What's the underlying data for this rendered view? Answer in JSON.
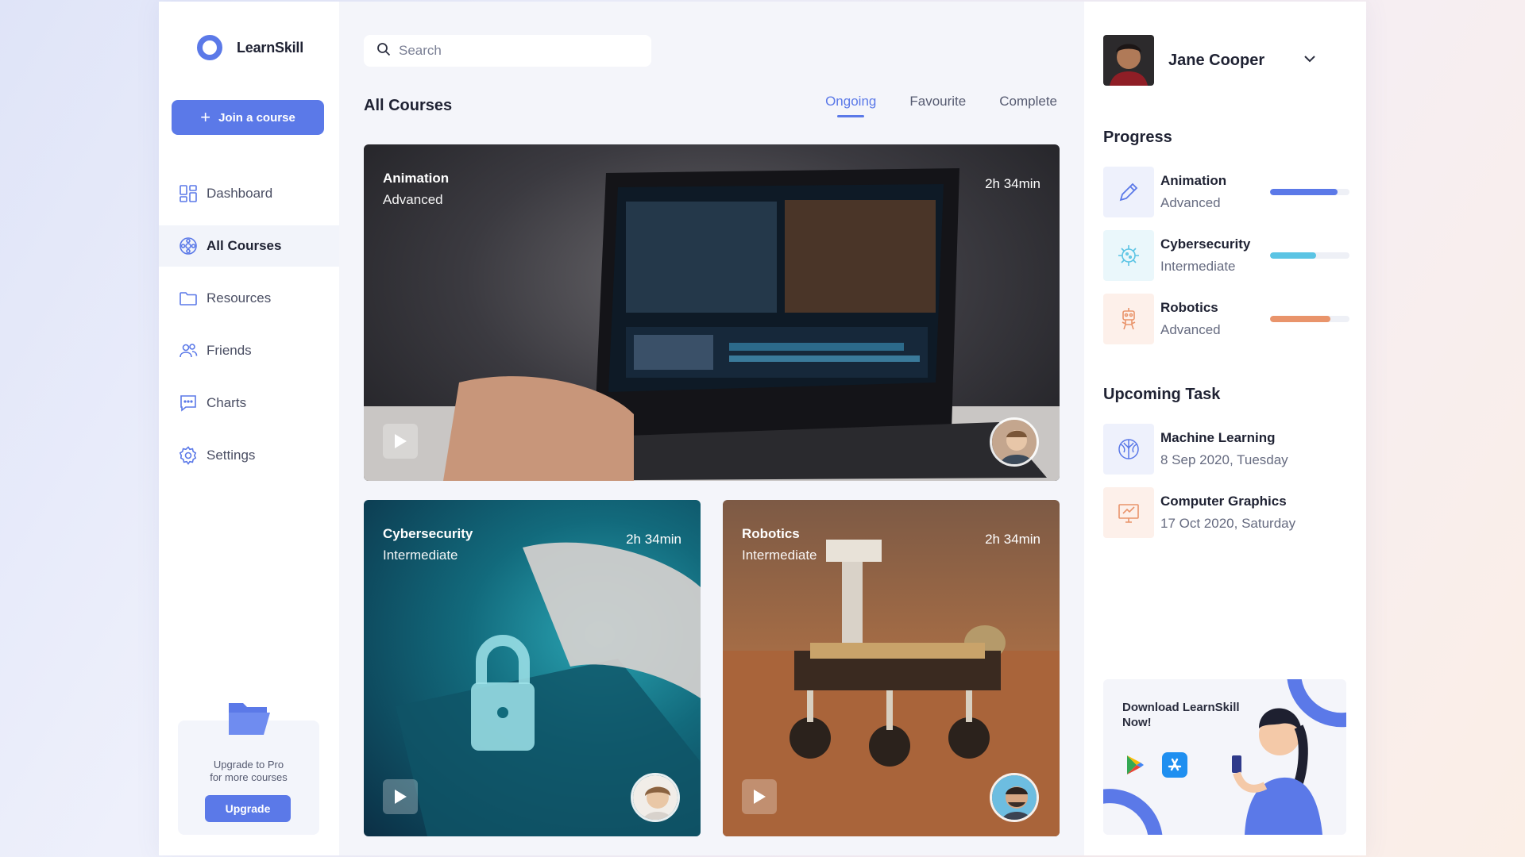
{
  "app": {
    "name": "LearnSkill"
  },
  "sidebar": {
    "join_label": "Join a course",
    "items": [
      {
        "label": "Dashboard",
        "icon": "dashboard-icon"
      },
      {
        "label": "All Courses",
        "icon": "courses-icon",
        "active": true
      },
      {
        "label": "Resources",
        "icon": "folder-icon"
      },
      {
        "label": "Friends",
        "icon": "friends-icon"
      },
      {
        "label": "Charts",
        "icon": "chat-icon"
      },
      {
        "label": "Settings",
        "icon": "gear-icon"
      }
    ],
    "upgrade": {
      "text_line1": "Upgrade to Pro",
      "text_line2": "for more courses",
      "button": "Upgrade"
    }
  },
  "main": {
    "search_placeholder": "Search",
    "title": "All Courses",
    "tabs": [
      {
        "label": "Ongoing",
        "active": true
      },
      {
        "label": "Favourite"
      },
      {
        "label": "Complete"
      }
    ],
    "courses": [
      {
        "title": "Animation",
        "level": "Advanced",
        "duration": "2h 34min"
      },
      {
        "title": "Cybersecurity",
        "level": "Intermediate",
        "duration": "2h 34min"
      },
      {
        "title": "Robotics",
        "level": "Intermediate",
        "duration": "2h 34min"
      }
    ]
  },
  "right": {
    "user_name": "Jane Cooper",
    "progress_title": "Progress",
    "progress": [
      {
        "title": "Animation",
        "level": "Advanced",
        "value": 0.85,
        "color": "#5b79e8",
        "icon": "pencil-icon"
      },
      {
        "title": "Cybersecurity",
        "level": "Intermediate",
        "value": 0.58,
        "color": "#5bc4e4",
        "icon": "virus-icon"
      },
      {
        "title": "Robotics",
        "level": "Advanced",
        "value": 0.76,
        "color": "#e9946b",
        "icon": "robot-icon"
      }
    ],
    "upcoming_title": "Upcoming Task",
    "tasks": [
      {
        "title": "Machine Learning",
        "date": "8 Sep 2020, Tuesday",
        "icon": "brain-icon"
      },
      {
        "title": "Computer Graphics",
        "date": "17 Oct 2020, Saturday",
        "icon": "graphics-icon"
      }
    ],
    "download": {
      "line1": "Download LearnSkill",
      "line2": "Now!"
    }
  },
  "colors": {
    "accent": "#5b79e8",
    "cyan": "#5bc4e4",
    "orange": "#e9946b"
  }
}
